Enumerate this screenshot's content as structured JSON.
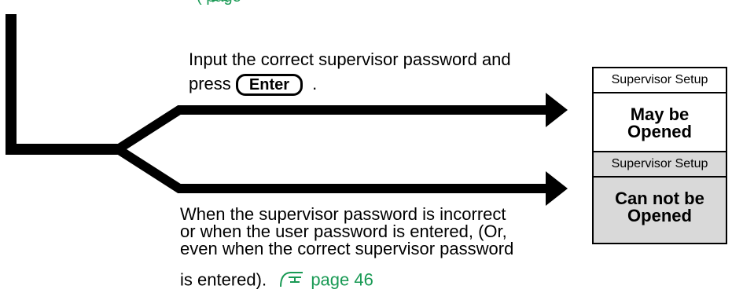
{
  "top_fragment": {
    "text": "(",
    "page_ref": "page"
  },
  "upper_path": {
    "instruction_before_key": "Input the correct supervisor password and",
    "press_label": "press",
    "key_label": "Enter",
    "after_key": "."
  },
  "lower_path": {
    "line1": "When the supervisor password is incorrect",
    "line2": "or when the user password is entered, (Or,",
    "line3": "even when the correct supervisor password",
    "line4": "is entered).",
    "page_ref": "page 46"
  },
  "box_open": {
    "header": "Supervisor Setup",
    "line1": "May be",
    "line2": "Opened",
    "bg_color": "#ffffff"
  },
  "box_closed": {
    "header": "Supervisor Setup",
    "line1": "Can not be",
    "line2": "Opened",
    "bg_color": "#d9d9d9"
  },
  "colors": {
    "link": "#1a9a55",
    "line": "#000000"
  },
  "icons": {
    "page_reference": "pointing-hand-icon"
  }
}
